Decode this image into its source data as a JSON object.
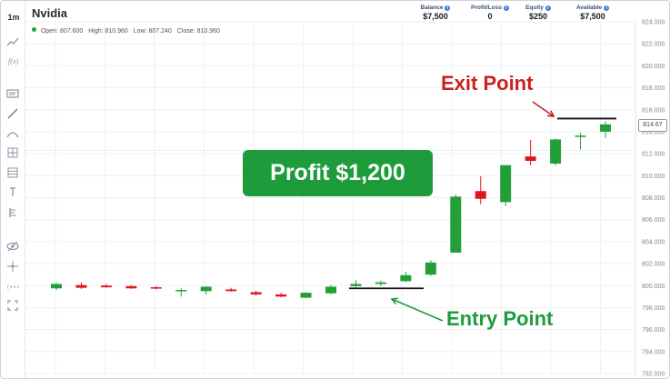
{
  "toolbar": {
    "timeframe": "1m",
    "icons": [
      "line-chart-icon",
      "formula-icon",
      "comment-icon",
      "trendline-icon",
      "arc-icon",
      "crosshair-box-icon",
      "grid-icon",
      "brush-icon",
      "fibonacci-icon",
      "eye-icon",
      "move-icon",
      "sequence-icon",
      "fullscreen-icon"
    ]
  },
  "header": {
    "title": "Nvidia",
    "ohlc": {
      "open": "Open: 807.600",
      "high": "High: 810.960",
      "low": "Low: 807.240",
      "close": "Close: 810.960"
    }
  },
  "stats": [
    {
      "label": "Balance",
      "value": "$7,500"
    },
    {
      "label": "Profit/Loss",
      "value": "0"
    },
    {
      "label": "Equity",
      "value": "$250"
    },
    {
      "label": "Available",
      "value": "$7,500"
    }
  ],
  "current_price": "814.67",
  "annotations": {
    "profit": "Profit $1,200",
    "exit": "Exit Point",
    "entry": "Entry Point"
  },
  "colors": {
    "up": "#21a038",
    "down": "#e0141f",
    "annotation_green": "#1e9c3c",
    "annotation_red": "#cc1f1f"
  },
  "chart_data": {
    "type": "candlestick",
    "title": "",
    "ylim": [
      792,
      824
    ],
    "y_ticks": [
      "824.000",
      "822.000",
      "820.000",
      "818.000",
      "816.000",
      "814.000",
      "812.000",
      "810.000",
      "808.000",
      "806.000",
      "804.000",
      "802.000",
      "800.000",
      "798.000",
      "796.000",
      "794.000",
      "792.000"
    ],
    "candles": [
      {
        "o": 800.15,
        "h": 800.25,
        "l": 799.6,
        "c": 799.75,
        "dir": "up"
      },
      {
        "o": 800.05,
        "h": 800.3,
        "l": 799.7,
        "c": 799.8,
        "dir": "down"
      },
      {
        "o": 800.0,
        "h": 800.15,
        "l": 799.8,
        "c": 799.85,
        "dir": "down"
      },
      {
        "o": 799.95,
        "h": 800.05,
        "l": 799.7,
        "c": 799.75,
        "dir": "down"
      },
      {
        "o": 799.85,
        "h": 799.95,
        "l": 799.65,
        "c": 799.75,
        "dir": "down"
      },
      {
        "o": 799.6,
        "h": 799.75,
        "l": 799.0,
        "c": 799.6,
        "dir": "up"
      },
      {
        "o": 799.5,
        "h": 799.95,
        "l": 799.2,
        "c": 799.9,
        "dir": "up"
      },
      {
        "o": 799.65,
        "h": 799.8,
        "l": 799.45,
        "c": 799.5,
        "dir": "down"
      },
      {
        "o": 799.4,
        "h": 799.55,
        "l": 799.1,
        "c": 799.2,
        "dir": "down"
      },
      {
        "o": 799.2,
        "h": 799.35,
        "l": 798.95,
        "c": 799.0,
        "dir": "down"
      },
      {
        "o": 798.9,
        "h": 799.4,
        "l": 798.85,
        "c": 799.35,
        "dir": "up"
      },
      {
        "o": 799.3,
        "h": 800.05,
        "l": 799.2,
        "c": 799.9,
        "dir": "up"
      },
      {
        "o": 799.95,
        "h": 800.5,
        "l": 799.85,
        "c": 800.15,
        "dir": "up"
      },
      {
        "o": 800.15,
        "h": 800.45,
        "l": 799.95,
        "c": 800.3,
        "dir": "up"
      },
      {
        "o": 800.4,
        "h": 801.25,
        "l": 800.3,
        "c": 800.95,
        "dir": "up"
      },
      {
        "o": 801.0,
        "h": 802.3,
        "l": 800.9,
        "c": 802.1,
        "dir": "up"
      },
      {
        "o": 803.0,
        "h": 808.3,
        "l": 803.0,
        "c": 808.1,
        "dir": "up"
      },
      {
        "o": 808.6,
        "h": 809.95,
        "l": 807.4,
        "c": 807.9,
        "dir": "down"
      },
      {
        "o": 807.6,
        "h": 810.96,
        "l": 807.24,
        "c": 810.96,
        "dir": "up"
      },
      {
        "o": 811.75,
        "h": 813.25,
        "l": 810.95,
        "c": 811.35,
        "dir": "down"
      },
      {
        "o": 811.1,
        "h": 813.4,
        "l": 810.95,
        "c": 813.3,
        "dir": "up"
      },
      {
        "o": 813.65,
        "h": 813.9,
        "l": 812.4,
        "c": 813.6,
        "dir": "up"
      },
      {
        "o": 814.0,
        "h": 814.95,
        "l": 813.45,
        "c": 814.67,
        "dir": "up"
      }
    ],
    "entry_line": 799.75,
    "exit_line": 815.2
  }
}
